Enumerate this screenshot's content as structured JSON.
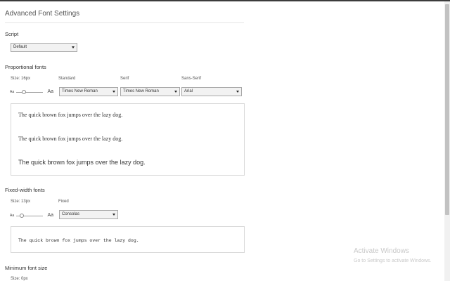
{
  "title": "Advanced Font Settings",
  "script": {
    "label": "Script",
    "value": "Default"
  },
  "proportional": {
    "label": "Proportional fonts",
    "size_label": "Size: 16px",
    "size_value": 16,
    "slider_small": "Aa",
    "slider_big": "Aa",
    "standard": {
      "label": "Standard",
      "value": "Times New Roman"
    },
    "serif": {
      "label": "Serif",
      "value": "Times New Roman"
    },
    "sans_serif": {
      "label": "Sans-Serif",
      "value": "Arial"
    },
    "samples": [
      "The quick brown fox jumps over the lazy dog.",
      "The quick brown fox jumps over the lazy dog.",
      "The quick brown fox jumps over the lazy dog."
    ]
  },
  "fixed_width": {
    "label": "Fixed-width fonts",
    "size_label": "Size: 13px",
    "size_value": 13,
    "slider_small": "Aa",
    "slider_big": "Aa",
    "fixed": {
      "label": "Fixed",
      "value": "Consolas"
    },
    "sample": "The quick brown fox jumps over the lazy dog."
  },
  "minimum": {
    "label": "Minimum font size",
    "size_label": "Size: 0px"
  },
  "watermark": {
    "line1": "Activate Windows",
    "line2": "Go to Settings to activate Windows."
  }
}
